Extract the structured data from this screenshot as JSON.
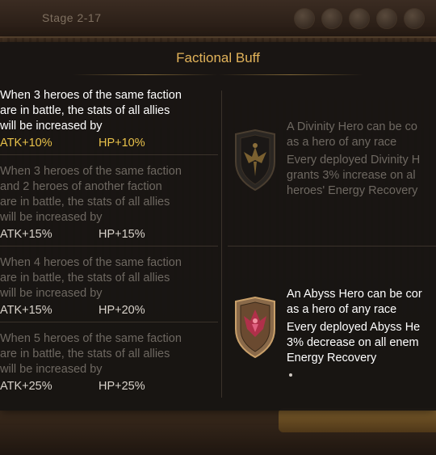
{
  "header": {
    "stage_label": "Stage 2-17",
    "icons": [
      "menu-icon",
      "chat-icon",
      "mail-icon",
      "settings-icon",
      "gift-icon"
    ]
  },
  "panel": {
    "title": "Factional Buff",
    "tiers": [
      {
        "description": [
          "When 3 heroes of the same faction",
          "are in battle, the stats of all allies",
          "will be increased by"
        ],
        "atk": "ATK+10%",
        "hp": "HP+10%",
        "active": true
      },
      {
        "description": [
          "When 3 heroes of the same faction",
          "and 2 heroes of another faction",
          "are in battle, the stats of all allies",
          "will be increased by"
        ],
        "atk": "ATK+15%",
        "hp": "HP+15%",
        "active": false
      },
      {
        "description": [
          "When 4 heroes of the same faction",
          "are in battle, the stats of all allies",
          "will be increased by"
        ],
        "atk": "ATK+15%",
        "hp": "HP+20%",
        "active": false
      },
      {
        "description": [
          "When 5 heroes of the same faction",
          "are in battle, the stats of all allies",
          "will be increased by"
        ],
        "atk": "ATK+25%",
        "hp": "HP+25%",
        "active": false
      }
    ],
    "divinity": {
      "icon": "divinity-shield-icon",
      "lines": [
        "A Divinity Hero can be co",
        "as a hero of any race",
        "Every deployed Divinity H",
        "grants 3% increase on al",
        "heroes' Energy Recovery"
      ]
    },
    "abyss": {
      "icon": "abyss-shield-icon",
      "lines": [
        "An Abyss Hero can be cor",
        "as a hero of any race",
        "Every deployed Abyss He",
        "3% decrease on all enem",
        "Energy Recovery"
      ]
    }
  },
  "colors": {
    "title": "#e2b35a",
    "active_stat": "#e8c14a",
    "inactive_text": "#6e6861",
    "active_text": "#ffffff"
  }
}
